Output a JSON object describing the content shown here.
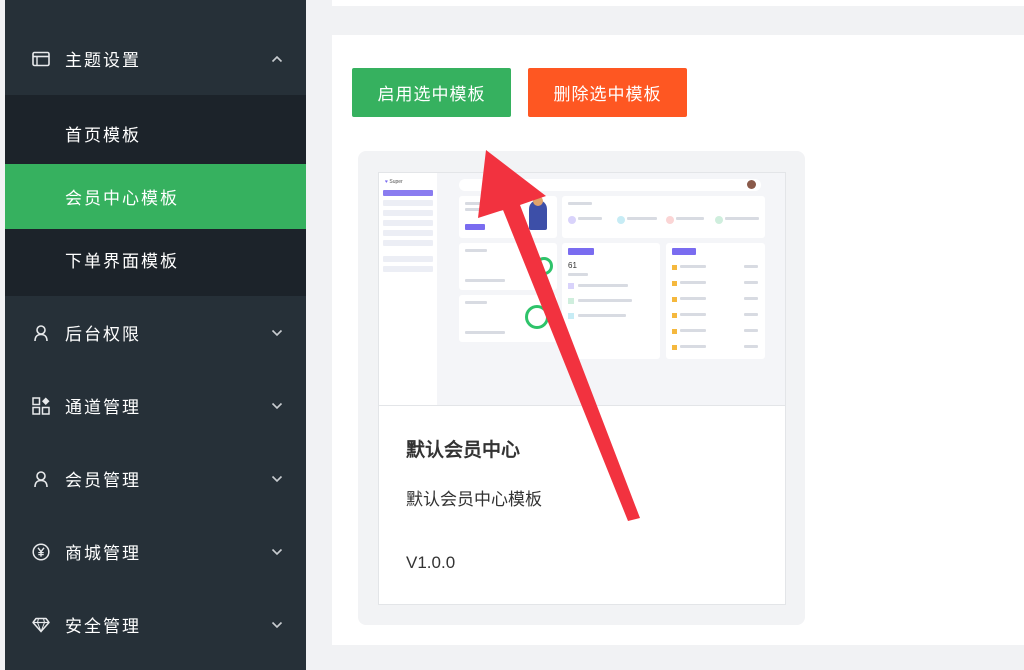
{
  "sidebar": {
    "theme": {
      "label": "主题设置",
      "icon": "window-icon",
      "expanded": true
    },
    "submenu": [
      {
        "label": "首页模板",
        "active": false
      },
      {
        "label": "会员中心模板",
        "active": true
      },
      {
        "label": "下单界面模板",
        "active": false
      }
    ],
    "items": [
      {
        "label": "后台权限",
        "icon": "user-icon"
      },
      {
        "label": "通道管理",
        "icon": "apps-icon"
      },
      {
        "label": "会员管理",
        "icon": "user-icon"
      },
      {
        "label": "商城管理",
        "icon": "yen-icon"
      },
      {
        "label": "安全管理",
        "icon": "diamond-icon"
      }
    ]
  },
  "toolbar": {
    "enable_label": "启用选中模板",
    "delete_label": "删除选中模板"
  },
  "template_card": {
    "title": "默认会员中心",
    "description": "默认会员中心模板",
    "version": "V1.0.0"
  },
  "preview": {
    "logo": "Super",
    "stat": "61"
  },
  "colors": {
    "sidebar_bg": "#263038",
    "submenu_bg": "#1c232a",
    "accent_green": "#36b15f",
    "danger_orange": "#fe5722",
    "annotation_arrow": "#f2323f"
  }
}
